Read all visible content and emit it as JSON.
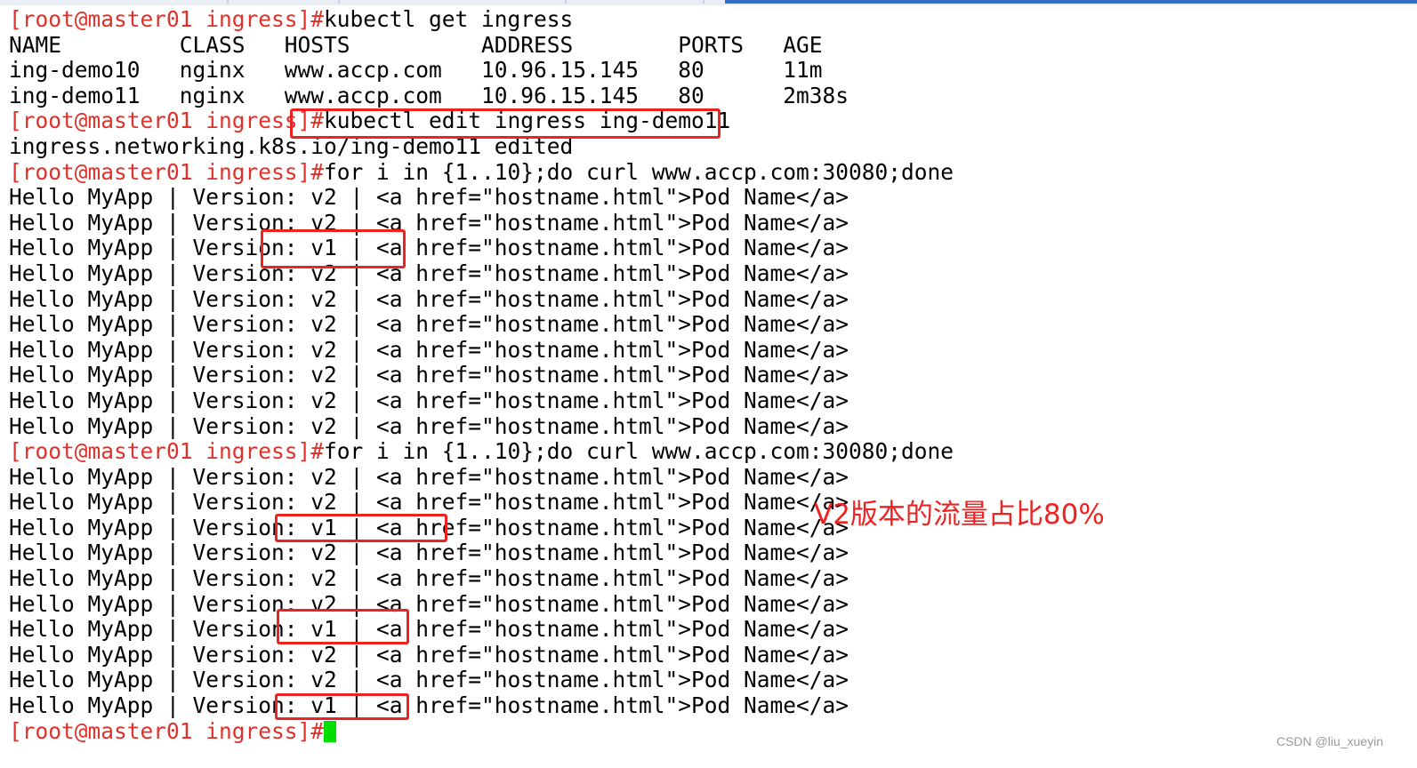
{
  "terminal": {
    "lines": [
      {
        "prompt": "[root@master01 ingress]#",
        "text": "kubectl get ingress"
      },
      {
        "prompt": "",
        "text": "NAME         CLASS   HOSTS          ADDRESS        PORTS   AGE"
      },
      {
        "prompt": "",
        "text": "ing-demo10   nginx   www.accp.com   10.96.15.145   80      11m"
      },
      {
        "prompt": "",
        "text": "ing-demo11   nginx   www.accp.com   10.96.15.145   80      2m38s"
      },
      {
        "prompt": "[root@master01 ingress]#",
        "text": "kubectl edit ingress ing-demo11"
      },
      {
        "prompt": "",
        "text": "ingress.networking.k8s.io/ing-demo11 edited"
      },
      {
        "prompt": "[root@master01 ingress]#",
        "text": "for i in {1..10};do curl www.accp.com:30080;done"
      },
      {
        "prompt": "",
        "text": "Hello MyApp | Version: v2 | <a href=\"hostname.html\">Pod Name</a>"
      },
      {
        "prompt": "",
        "text": "Hello MyApp | Version: v2 | <a href=\"hostname.html\">Pod Name</a>"
      },
      {
        "prompt": "",
        "text": "Hello MyApp | Version: v1 | <a href=\"hostname.html\">Pod Name</a>"
      },
      {
        "prompt": "",
        "text": "Hello MyApp | Version: v2 | <a href=\"hostname.html\">Pod Name</a>"
      },
      {
        "prompt": "",
        "text": "Hello MyApp | Version: v2 | <a href=\"hostname.html\">Pod Name</a>"
      },
      {
        "prompt": "",
        "text": "Hello MyApp | Version: v2 | <a href=\"hostname.html\">Pod Name</a>"
      },
      {
        "prompt": "",
        "text": "Hello MyApp | Version: v2 | <a href=\"hostname.html\">Pod Name</a>"
      },
      {
        "prompt": "",
        "text": "Hello MyApp | Version: v2 | <a href=\"hostname.html\">Pod Name</a>"
      },
      {
        "prompt": "",
        "text": "Hello MyApp | Version: v2 | <a href=\"hostname.html\">Pod Name</a>"
      },
      {
        "prompt": "",
        "text": "Hello MyApp | Version: v2 | <a href=\"hostname.html\">Pod Name</a>"
      },
      {
        "prompt": "[root@master01 ingress]#",
        "text": "for i in {1..10};do curl www.accp.com:30080;done"
      },
      {
        "prompt": "",
        "text": "Hello MyApp | Version: v2 | <a href=\"hostname.html\">Pod Name</a>"
      },
      {
        "prompt": "",
        "text": "Hello MyApp | Version: v2 | <a href=\"hostname.html\">Pod Name</a>"
      },
      {
        "prompt": "",
        "text": "Hello MyApp | Version: v1 | <a href=\"hostname.html\">Pod Name</a>"
      },
      {
        "prompt": "",
        "text": "Hello MyApp | Version: v2 | <a href=\"hostname.html\">Pod Name</a>"
      },
      {
        "prompt": "",
        "text": "Hello MyApp | Version: v2 | <a href=\"hostname.html\">Pod Name</a>"
      },
      {
        "prompt": "",
        "text": "Hello MyApp | Version: v2 | <a href=\"hostname.html\">Pod Name</a>"
      },
      {
        "prompt": "",
        "text": "Hello MyApp | Version: v1 | <a href=\"hostname.html\">Pod Name</a>"
      },
      {
        "prompt": "",
        "text": "Hello MyApp | Version: v2 | <a href=\"hostname.html\">Pod Name</a>"
      },
      {
        "prompt": "",
        "text": "Hello MyApp | Version: v2 | <a href=\"hostname.html\">Pod Name</a>"
      },
      {
        "prompt": "",
        "text": "Hello MyApp | Version: v1 | <a href=\"hostname.html\">Pod Name</a>"
      },
      {
        "prompt": "[root@master01 ingress]#",
        "text": "",
        "cursor": true
      }
    ]
  },
  "annotation": {
    "text": "V2版本的流量占比80%"
  },
  "watermark": {
    "text": "CSDN @liu_xueyin"
  },
  "colors": {
    "prompt": "#e0312b",
    "text": "#000000",
    "highlight": "#ee2222",
    "cursor": "#00e000",
    "background": "#ffffff"
  }
}
